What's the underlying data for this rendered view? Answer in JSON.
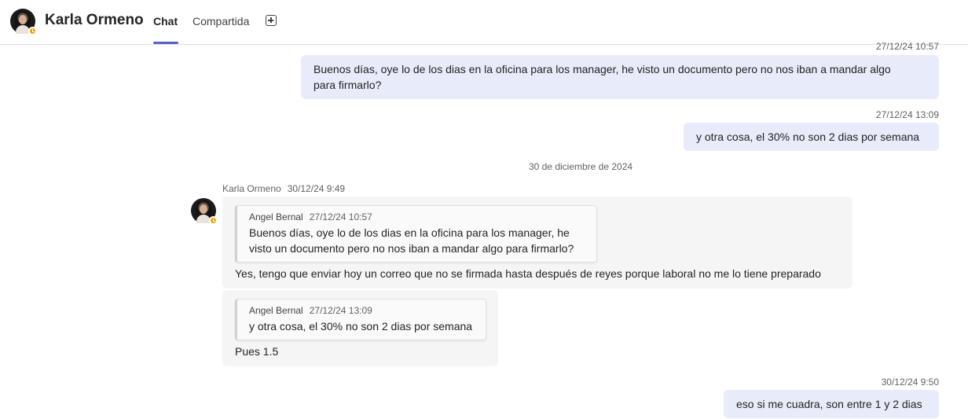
{
  "header": {
    "contact_name": "Karla Ormeno",
    "tabs": [
      {
        "label": "Chat",
        "active": true
      },
      {
        "label": "Compartida",
        "active": false
      }
    ],
    "add_tab_icon": "plus-square-icon",
    "presence_status": "away",
    "accent_color": "#5b5fc7"
  },
  "messages": {
    "out1": {
      "timestamp": "27/12/24 10:57",
      "line1": "Buenos días, oye lo de los dias en la oficina para los manager, he visto un documento pero no nos iban a mandar algo",
      "line2": "para firmarlo?"
    },
    "out2": {
      "timestamp": "27/12/24 13:09",
      "text": "y otra cosa, el 30% no son 2 dias por semana"
    },
    "date_separator": "30 de diciembre de 2024",
    "incoming": {
      "sender": "Karla Ormeno",
      "timestamp": "30/12/24 9:49",
      "reply1": {
        "quote_author": "Angel Bernal",
        "quote_time": "27/12/24 10:57",
        "quote_line1": "Buenos días, oye lo de los dias en la oficina para los manager, he",
        "quote_line2": "visto un documento pero no nos iban a mandar algo para firmarlo?",
        "text": "Yes, tengo que enviar hoy un correo que no se firmada hasta después de reyes porque laboral no me lo tiene preparado"
      },
      "reply2": {
        "quote_author": "Angel Bernal",
        "quote_time": "27/12/24 13:09",
        "quote_text": "y otra cosa, el 30% no son 2 dias por semana",
        "text": "Pues 1.5"
      }
    },
    "out3": {
      "timestamp": "30/12/24 9:50",
      "text": "eso si me cuadra, son entre 1 y 2 dias"
    }
  }
}
